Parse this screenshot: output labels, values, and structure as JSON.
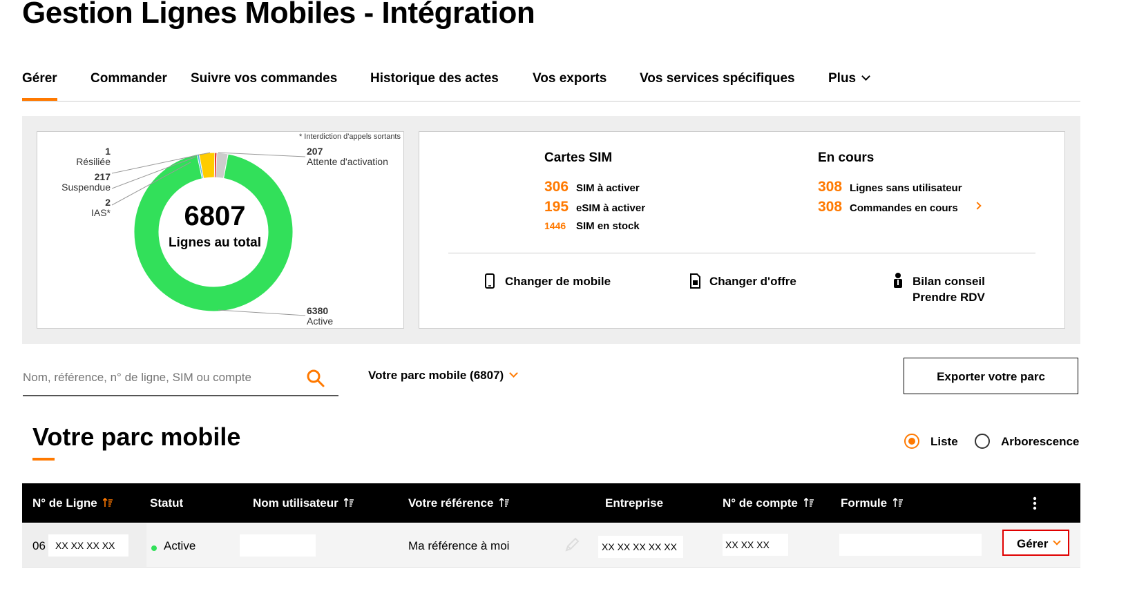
{
  "page": {
    "title": "Gestion Lignes Mobiles - Intégration"
  },
  "nav": {
    "items": [
      "Gérer",
      "Commander",
      "Suivre vos commandes",
      "Historique des actes",
      "Vos exports",
      "Vos services spécifiques",
      "Plus"
    ],
    "active": "Gérer"
  },
  "donut": {
    "note": "* Interdiction d'appels sortants",
    "total": "6807",
    "total_label": "Lignes au total",
    "segments": [
      {
        "count": "1",
        "label": "Résiliée",
        "value": 1,
        "color": "#e00000"
      },
      {
        "count": "217",
        "label": "Suspendue",
        "value": 217,
        "color": "#ffcc00"
      },
      {
        "count": "2",
        "label": "IAS*",
        "value": 2,
        "color": "#4bb4e6"
      },
      {
        "count": "207",
        "label": "Attente d'activation",
        "value": 207,
        "color": "#cccccc"
      },
      {
        "count": "6380",
        "label": "Active",
        "value": 6380,
        "color": "#32e05a"
      }
    ]
  },
  "sim_cards": {
    "title": "Cartes SIM",
    "items": [
      {
        "count": "306",
        "label": "SIM à activer"
      },
      {
        "count": "195",
        "label": "eSIM à activer"
      },
      {
        "count": "1446",
        "label": "SIM en stock"
      }
    ]
  },
  "in_progress": {
    "title": "En cours",
    "items": [
      {
        "count": "308",
        "label": "Lignes sans utilisateur"
      },
      {
        "count": "308",
        "label": "Commandes en cours"
      }
    ]
  },
  "actions": {
    "change_mobile": "Changer de mobile",
    "change_offer": "Changer d'offre",
    "bilan_line1": "Bilan conseil",
    "bilan_line2": "Prendre RDV"
  },
  "search": {
    "placeholder": "Nom, référence, n° de ligne, SIM ou compte"
  },
  "parc_selector": {
    "label": "Votre parc mobile (6807)"
  },
  "export_button": {
    "label": "Exporter votre parc"
  },
  "section": {
    "title": "Votre parc mobile"
  },
  "view_toggle": {
    "options": [
      "Liste",
      "Arborescence"
    ],
    "selected": "Liste"
  },
  "table": {
    "headers": [
      "N° de Ligne",
      "Statut",
      "Nom utilisateur",
      "Votre référence",
      "Entreprise",
      "N° de compte",
      "Formule"
    ],
    "rows": [
      {
        "line_prefix": "06",
        "line_number": "XX XX XX XX",
        "status": "Active",
        "user_name": "",
        "reference": "Ma référence à moi",
        "company": "XX XX XX XX XX",
        "account": "XX XX  XX",
        "formula": "",
        "action": "Gérer"
      }
    ]
  },
  "colors": {
    "accent": "#ff7900",
    "active_green": "#32e05a",
    "highlight_red": "#e00000"
  }
}
